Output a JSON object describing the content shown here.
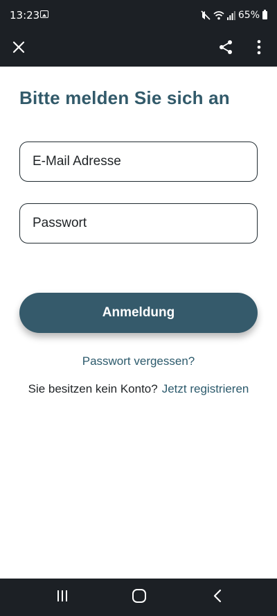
{
  "status_bar": {
    "time": "13:23",
    "battery": "65%",
    "icons": [
      "gallery-notification-icon",
      "mute-icon",
      "wifi-icon",
      "signal-icon",
      "battery-icon"
    ]
  },
  "app_bar": {
    "icons": [
      "close-icon",
      "share-icon",
      "more-vert-icon"
    ]
  },
  "login": {
    "title": "Bitte melden Sie sich an",
    "email_placeholder": "E-Mail Adresse",
    "password_placeholder": "Passwort",
    "submit_label": "Anmeldung",
    "forgot_password": "Passwort vergessen?",
    "no_account_text": "Sie besitzen kein Konto?",
    "register_link": "Jetzt registrieren"
  },
  "nav_bar": {
    "icons": [
      "recents-icon",
      "home-icon",
      "back-icon"
    ]
  },
  "colors": {
    "bar_background": "#1c2025",
    "accent": "#355a6b",
    "link": "#2c5a6c",
    "title": "#325a6a"
  }
}
